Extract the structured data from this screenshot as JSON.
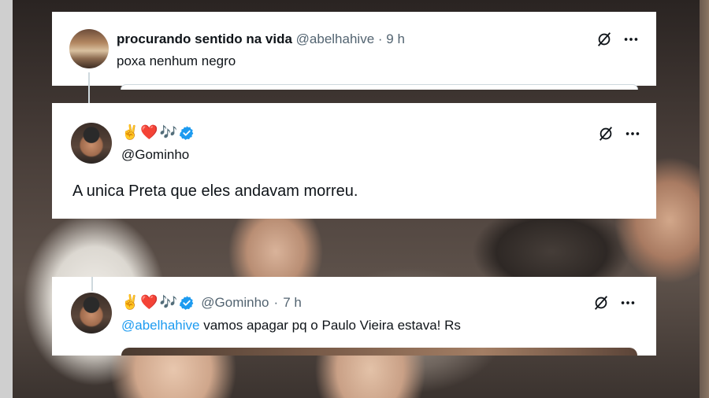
{
  "tweets": [
    {
      "display_name": "procurando sentido na vida",
      "handle": "@abelhahive",
      "separator": "·",
      "time": "9 h",
      "text": "poxa nenhum negro",
      "icons": [
        "grok-icon",
        "more-icon"
      ]
    },
    {
      "emojis": [
        "✌️",
        "❤️",
        "🎶"
      ],
      "verified": true,
      "handle": "@Gominho",
      "text": "A unica Preta que eles andavam morreu.",
      "icons": [
        "grok-icon",
        "more-icon"
      ]
    },
    {
      "emojis": [
        "✌️",
        "❤️",
        "🎶"
      ],
      "verified": true,
      "handle": "@Gominho",
      "separator": "·",
      "time": "7 h",
      "mention": "@abelhahive",
      "text": " vamos apagar pq o Paulo Vieira estava! Rs",
      "icons": [
        "grok-icon",
        "more-icon"
      ]
    }
  ],
  "colors": {
    "text": "#0f1419",
    "secondary": "#536471",
    "link": "#1d9bf0",
    "verified": "#1d9bf0",
    "card": "#ffffff"
  }
}
